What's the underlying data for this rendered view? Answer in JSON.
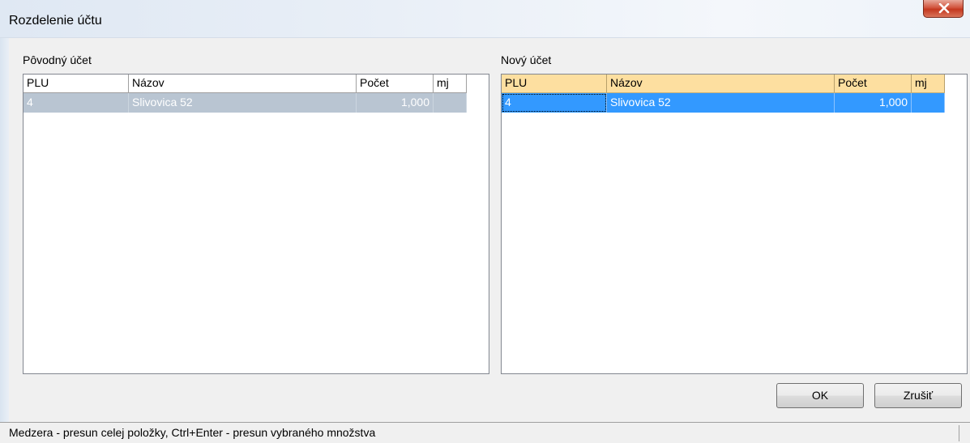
{
  "window": {
    "title": "Rozdelenie účtu"
  },
  "left_panel": {
    "label": "Pôvodný účet",
    "columns": [
      "PLU",
      "Názov",
      "Počet",
      "mj"
    ],
    "rows": [
      {
        "plu": "4",
        "name": "Slivovica 52",
        "count": "1,000",
        "unit": ""
      }
    ]
  },
  "right_panel": {
    "label": "Nový účet",
    "columns": [
      "PLU",
      "Názov",
      "Počet",
      "mj"
    ],
    "rows": [
      {
        "plu": "4",
        "name": "Slivovica 52",
        "count": "1,000",
        "unit": ""
      }
    ]
  },
  "buttons": {
    "ok": "OK",
    "cancel": "Zrušiť"
  },
  "status": {
    "text": "Medzera - presun celej položky, Ctrl+Enter - presun vybraného množstva"
  },
  "colors": {
    "selection": "#3399ff",
    "inactive_selection": "#b9c5d2",
    "header_highlight": "#fddfa0"
  }
}
